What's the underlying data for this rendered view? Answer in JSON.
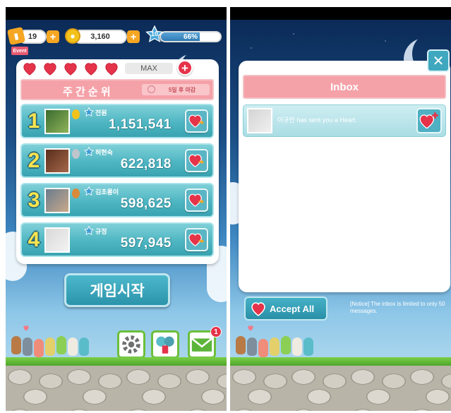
{
  "left_screen": {
    "top_bar": {
      "tickets": "19",
      "coins": "3,160",
      "level": "10",
      "exp_text": "66%",
      "exp_percent": 66,
      "event_tag": "Event"
    },
    "hearts": {
      "count": 5,
      "max_label": "MAX"
    },
    "weekly_rank": {
      "title": "주 간 순 위",
      "deadline": "5일 후 마감"
    },
    "ranks": [
      {
        "rank": "1",
        "name": "전원",
        "score": "1,151,541",
        "medal_color": "#f2c21b",
        "avatar_colors": [
          "#3b6b2e",
          "#8fb45a"
        ]
      },
      {
        "rank": "2",
        "name": "허현숙",
        "score": "622,818",
        "medal_color": "#bfc5cc",
        "avatar_colors": [
          "#5a2e1c",
          "#a4674a"
        ]
      },
      {
        "rank": "3",
        "name": "김초롱이",
        "score": "598,625",
        "medal_color": "#d98a3a",
        "avatar_colors": [
          "#6a7c8e",
          "#c9a98a"
        ]
      },
      {
        "rank": "4",
        "name": "규정",
        "score": "597,945",
        "medal_color": "",
        "avatar_colors": [
          "#d9d9d9",
          "#f2f2f2"
        ]
      }
    ],
    "start_button": "게임시작",
    "mail_badge": "1",
    "icons": {
      "settings": "gear-icon",
      "friends": "friends-icon",
      "mail": "mail-icon"
    }
  },
  "right_screen": {
    "inbox_title": "Inbox",
    "messages": [
      {
        "sender": "이규란",
        "text": "has sent you a Heart."
      }
    ],
    "accept_all_label": "Accept All",
    "notice": "[Notice] The inbox is limited to only 50 messages."
  },
  "colors": {
    "pink": "#f5a1a8",
    "teal": "#4eb6c2",
    "heart_red": "#e5334a"
  }
}
